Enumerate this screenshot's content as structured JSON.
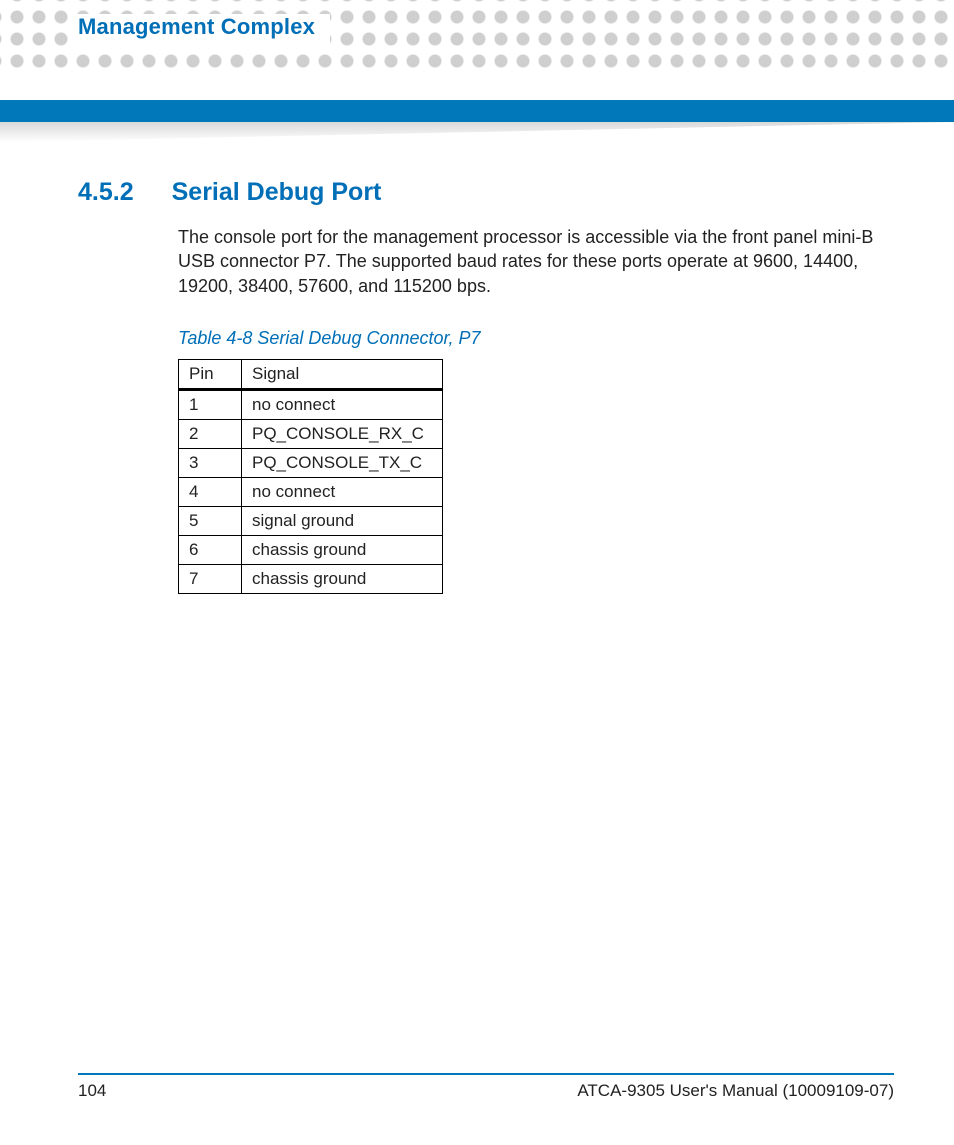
{
  "header": {
    "chapter_title": "Management Complex"
  },
  "section": {
    "number": "4.5.2",
    "title": "Serial Debug Port",
    "body": "The console port for the management processor is accessible via the front panel mini-B USB connector P7. The supported baud rates for these ports operate at 9600, 14400, 19200, 38400, 57600, and 115200 bps."
  },
  "table": {
    "caption": "Table 4-8 Serial Debug Connector, P7",
    "columns": [
      "Pin",
      "Signal"
    ],
    "rows": [
      {
        "pin": "1",
        "signal": "no connect"
      },
      {
        "pin": "2",
        "signal": "PQ_CONSOLE_RX_C"
      },
      {
        "pin": "3",
        "signal": "PQ_CONSOLE_TX_C"
      },
      {
        "pin": "4",
        "signal": "no connect"
      },
      {
        "pin": "5",
        "signal": "signal ground"
      },
      {
        "pin": "6",
        "signal": "chassis ground"
      },
      {
        "pin": "7",
        "signal": "chassis ground"
      }
    ]
  },
  "footer": {
    "page_number": "104",
    "doc_title": "ATCA-9305 User's Manual (10009109-07)"
  }
}
